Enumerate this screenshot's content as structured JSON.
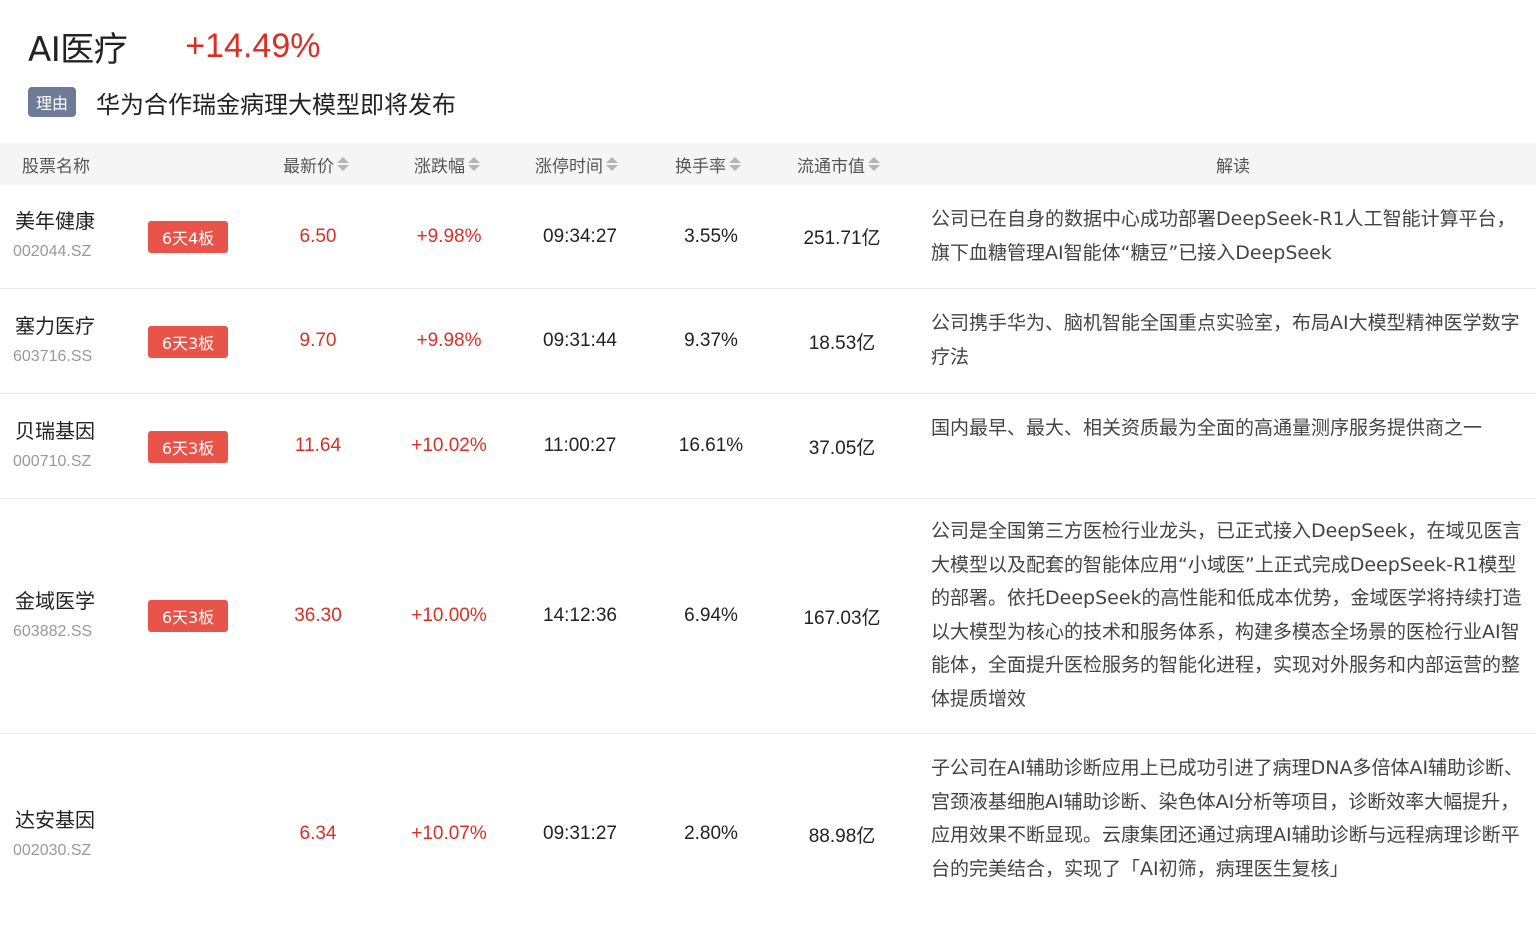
{
  "sector": {
    "name": "AI医疗",
    "change": "+14.49%"
  },
  "reason": {
    "tag": "理由",
    "text": "华为合作瑞金病理大模型即将发布"
  },
  "table": {
    "headers": {
      "name": "股票名称",
      "price": "最新价",
      "change": "涨跌幅",
      "limit_time": "涨停时间",
      "turnover": "换手率",
      "float_cap": "流通市值",
      "explain": "解读"
    },
    "rows": [
      {
        "name": "美年健康",
        "code": "002044.SZ",
        "badge": "6天4板",
        "price": "6.50",
        "change": "+9.98%",
        "limit_time": "09:34:27",
        "turnover": "3.55%",
        "float_cap": "251.71亿",
        "explain": "公司已在自身的数据中心成功部署DeepSeek-R1人工智能计算平台，旗下血糖管理AI智能体“糖豆”已接入DeepSeek"
      },
      {
        "name": "塞力医疗",
        "code": "603716.SS",
        "badge": "6天3板",
        "price": "9.70",
        "change": "+9.98%",
        "limit_time": "09:31:44",
        "turnover": "9.37%",
        "float_cap": "18.53亿",
        "explain": "公司携手华为、脑机智能全国重点实验室，布局AI大模型精神医学数字疗法"
      },
      {
        "name": "贝瑞基因",
        "code": "000710.SZ",
        "badge": "6天3板",
        "price": "11.64",
        "change": "+10.02%",
        "limit_time": "11:00:27",
        "turnover": "16.61%",
        "float_cap": "37.05亿",
        "explain": "国内最早、最大、相关资质最为全面的高通量测序服务提供商之一"
      },
      {
        "name": "金域医学",
        "code": "603882.SS",
        "badge": "6天3板",
        "price": "36.30",
        "change": "+10.00%",
        "limit_time": "14:12:36",
        "turnover": "6.94%",
        "float_cap": "167.03亿",
        "explain": "公司是全国第三方医检行业龙头，已正式接入DeepSeek，在域见医言大模型以及配套的智能体应用“小域医”上正式完成DeepSeek-R1模型的部署。依托DeepSeek的高性能和低成本优势，金域医学将持续打造以大模型为核心的技术和服务体系，构建多模态全场景的医检行业AI智能体，全面提升医检服务的智能化进程，实现对外服务和内部运营的整体提质增效"
      },
      {
        "name": "达安基因",
        "code": "002030.SZ",
        "badge": "",
        "price": "6.34",
        "change": "+10.07%",
        "limit_time": "09:31:27",
        "turnover": "2.80%",
        "float_cap": "88.98亿",
        "explain": "子公司在AI辅助诊断应用上已成功引进了病理DNA多倍体AI辅助诊断、宫颈液基细胞AI辅助诊断、染色体AI分析等项目，诊断效率大幅提升，应用效果不断显现。云康集团还通过病理AI辅助诊断与远程病理诊断平台的完美结合，实现了「AI初筛，病理医生复核」"
      }
    ]
  },
  "colors": {
    "up": "#d93026",
    "badge": "#e9544a",
    "reason_tag": "#6d7b96",
    "header_bg": "#f5f5f5"
  }
}
